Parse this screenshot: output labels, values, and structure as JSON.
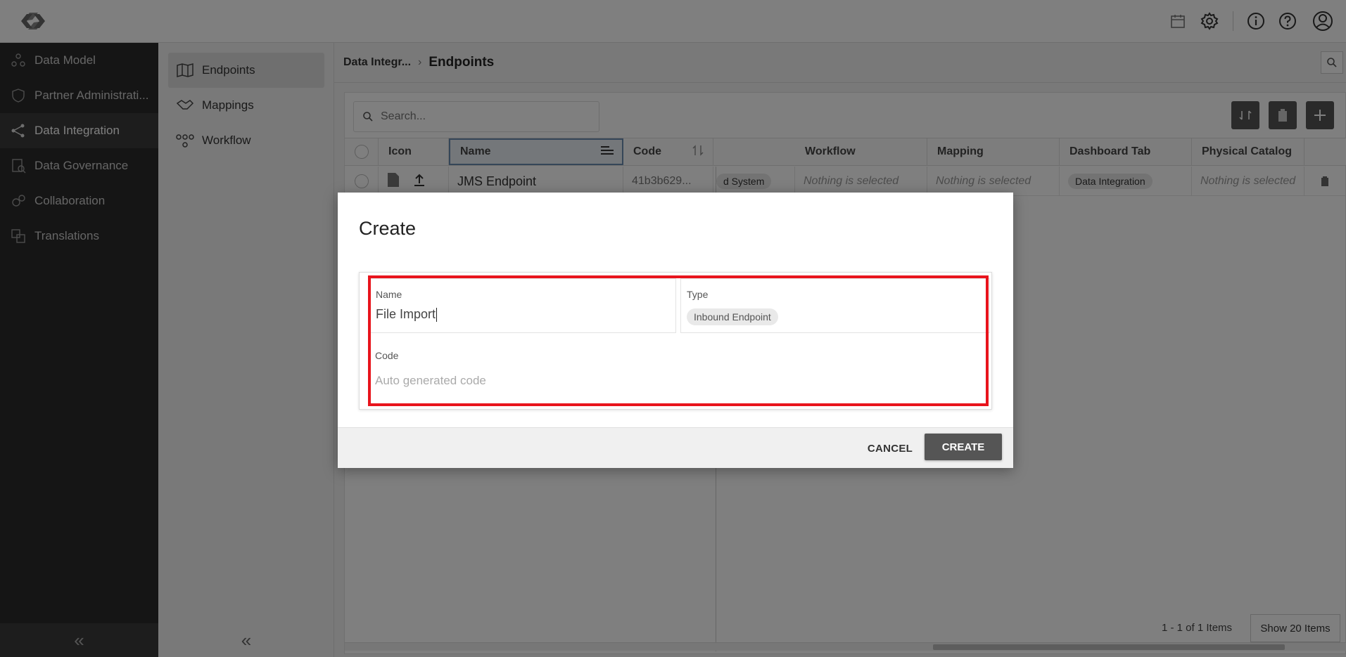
{
  "topbar": {
    "icons": [
      "logo-icon",
      "calendar-icon",
      "gear-icon",
      "info-icon",
      "help-icon",
      "user-avatar-icon"
    ]
  },
  "leftnav": {
    "items": [
      {
        "label": "Data Model",
        "icon": "data-model-icon"
      },
      {
        "label": "Partner Administrati...",
        "icon": "shield-icon"
      },
      {
        "label": "Data Integration",
        "icon": "share-nodes-icon",
        "active": true
      },
      {
        "label": "Data Governance",
        "icon": "governance-icon"
      },
      {
        "label": "Collaboration",
        "icon": "collaboration-icon"
      },
      {
        "label": "Translations",
        "icon": "translate-icon"
      }
    ],
    "collapse": "«"
  },
  "subnav": {
    "items": [
      {
        "label": "Endpoints",
        "icon": "map-icon",
        "active": true
      },
      {
        "label": "Mappings",
        "icon": "handshake-icon"
      },
      {
        "label": "Workflow",
        "icon": "workflow-icon"
      }
    ],
    "collapse": "«"
  },
  "breadcrumb": {
    "parent": "Data Integr...",
    "separator": "›",
    "current": "Endpoints"
  },
  "table": {
    "search_placeholder": "Search...",
    "columns": {
      "icon": "Icon",
      "name": "Name",
      "code": "Code",
      "workflow": "Workflow",
      "mapping": "Mapping",
      "dashboard_tab": "Dashboard Tab",
      "physical_catalog": "Physical Catalog"
    },
    "row": {
      "name": "JMS Endpoint",
      "code": "41b3b629...",
      "type_chip": "d System",
      "workflow": "Nothing is selected",
      "mapping": "Nothing is selected",
      "dashboard_tab": "Data Integration",
      "physical_catalog": "Nothing is selected"
    },
    "footer": {
      "count": "1 - 1 of 1 Items",
      "page_size": "Show 20 Items"
    }
  },
  "dialog": {
    "title": "Create",
    "name_label": "Name",
    "name_value": "File Import",
    "type_label": "Type",
    "type_value": "Inbound Endpoint",
    "code_label": "Code",
    "code_placeholder": "Auto generated code",
    "cancel_label": "CANCEL",
    "create_label": "CREATE",
    "highlight_color": "#e8141c"
  }
}
